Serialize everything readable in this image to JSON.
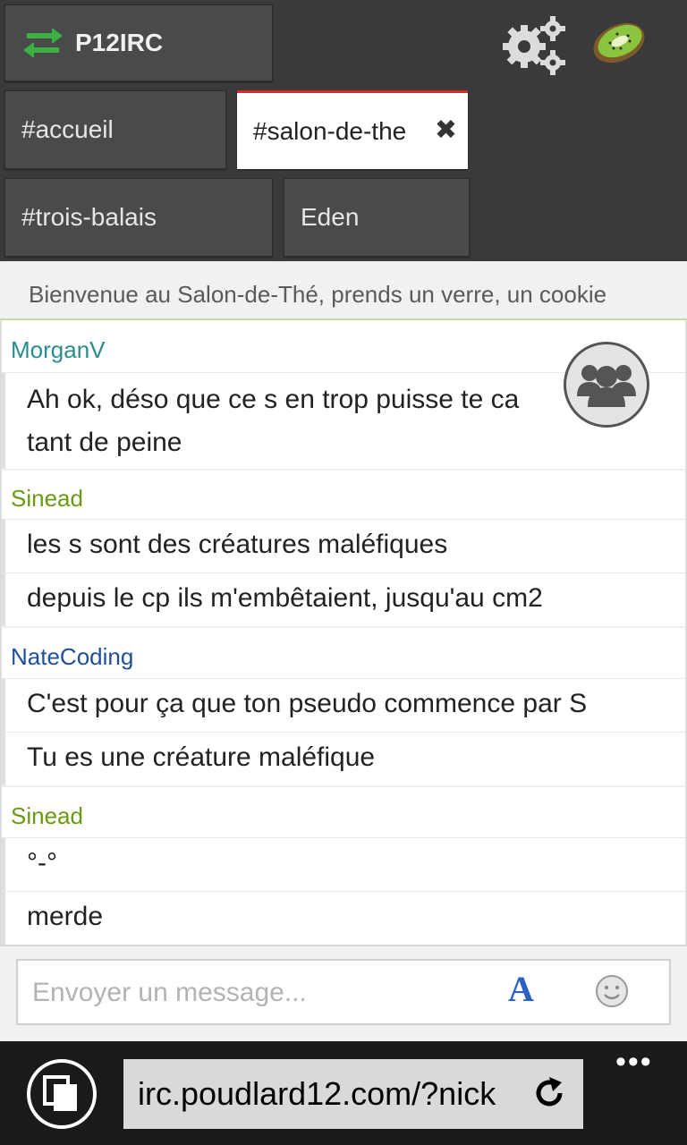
{
  "header": {
    "app_title": "P12IRC"
  },
  "tabs": [
    {
      "label": "#accueil"
    },
    {
      "label": "#salon-de-the"
    },
    {
      "label": "#trois-balais"
    },
    {
      "label": "Eden"
    }
  ],
  "topic": "Bienvenue au Salon-de-Thé, prends un verre, un cookie",
  "messages": [
    {
      "nick": "MorganV",
      "color": "#2a8c8c",
      "lines": [
        "Ah ok, déso que ce s en trop puisse te ca",
        "tant de peine"
      ]
    },
    {
      "nick": "Sinead",
      "color": "#6a9a12",
      "lines": [
        "les s sont des créatures maléfiques",
        "depuis le cp ils m'embêtaient, jusqu'au cm2"
      ]
    },
    {
      "nick": "NateCoding",
      "color": "#1f4f9a",
      "lines": [
        "C'est pour ça que ton pseudo commence par S",
        "Tu es une créature maléfique"
      ]
    },
    {
      "nick": "Sinead",
      "color": "#6a9a12",
      "lines": [
        "°-°",
        "merde"
      ]
    }
  ],
  "input": {
    "placeholder": "Envoyer un message...",
    "font_button": "A"
  },
  "browser": {
    "url": "irc.poudlard12.com/?nick",
    "more": "•••"
  },
  "icons": {
    "swap": "swap-arrows-icon",
    "settings": "gears-icon",
    "logo": "kiwi-icon",
    "users": "users-icon",
    "emoji": "smiley-icon",
    "tabs": "tabs-icon",
    "refresh": "refresh-icon"
  },
  "colors": {
    "accent_active_tab": "#d72a2a",
    "swap_icon": "#3cb044"
  }
}
